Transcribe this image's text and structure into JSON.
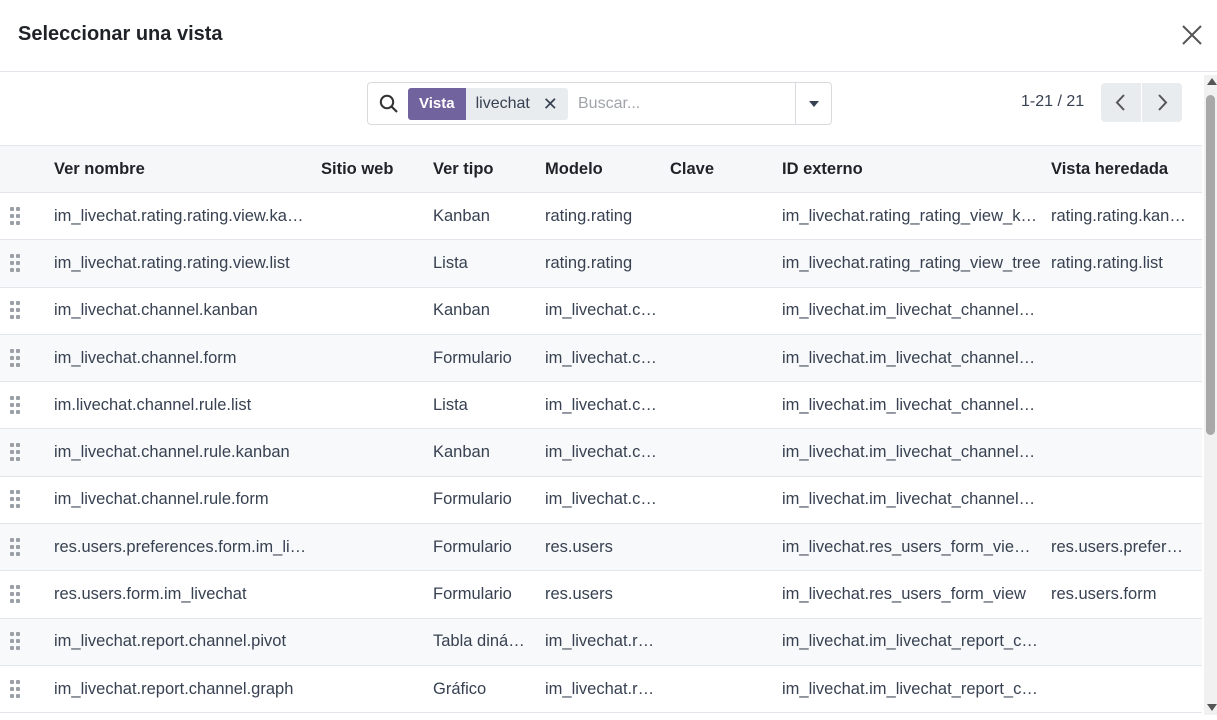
{
  "dialog": {
    "title": "Seleccionar una vista"
  },
  "search": {
    "facet_label": "Vista",
    "facet_value": "livechat",
    "placeholder": "Buscar..."
  },
  "pager": {
    "value": "1-21 / 21"
  },
  "table": {
    "columns": [
      "Ver nombre",
      "Sitio web",
      "Ver tipo",
      "Modelo",
      "Clave",
      "ID externo",
      "Vista heredada"
    ],
    "rows": [
      {
        "name": "im_livechat.rating.rating.view.kanban",
        "website": "",
        "type": "Kanban",
        "model": "rating.rating",
        "key": "",
        "external_id": "im_livechat.rating_rating_view_kanban",
        "inherited": "rating.rating.kanban"
      },
      {
        "name": "im_livechat.rating.rating.view.list",
        "website": "",
        "type": "Lista",
        "model": "rating.rating",
        "key": "",
        "external_id": "im_livechat.rating_rating_view_tree",
        "inherited": "rating.rating.list"
      },
      {
        "name": "im_livechat.channel.kanban",
        "website": "",
        "type": "Kanban",
        "model": "im_livechat.channel",
        "key": "",
        "external_id": "im_livechat.im_livechat_channel_view_kanban",
        "inherited": ""
      },
      {
        "name": "im_livechat.channel.form",
        "website": "",
        "type": "Formulario",
        "model": "im_livechat.channel",
        "key": "",
        "external_id": "im_livechat.im_livechat_channel_view_form",
        "inherited": ""
      },
      {
        "name": "im.livechat.channel.rule.list",
        "website": "",
        "type": "Lista",
        "model": "im_livechat.channel.rule",
        "key": "",
        "external_id": "im_livechat.im_livechat_channel_rule_view_tree",
        "inherited": ""
      },
      {
        "name": "im_livechat.channel.rule.kanban",
        "website": "",
        "type": "Kanban",
        "model": "im_livechat.channel.rule",
        "key": "",
        "external_id": "im_livechat.im_livechat_channel_rule_view_kanban",
        "inherited": ""
      },
      {
        "name": "im_livechat.channel.rule.form",
        "website": "",
        "type": "Formulario",
        "model": "im_livechat.channel.rule",
        "key": "",
        "external_id": "im_livechat.im_livechat_channel_rule_view_form",
        "inherited": ""
      },
      {
        "name": "res.users.preferences.form.im_livechat",
        "website": "",
        "type": "Formulario",
        "model": "res.users",
        "key": "",
        "external_id": "im_livechat.res_users_form_view_simple",
        "inherited": "res.users.preferences.form"
      },
      {
        "name": "res.users.form.im_livechat",
        "website": "",
        "type": "Formulario",
        "model": "res.users",
        "key": "",
        "external_id": "im_livechat.res_users_form_view",
        "inherited": "res.users.form"
      },
      {
        "name": "im_livechat.report.channel.pivot",
        "website": "",
        "type": "Tabla dinámica",
        "model": "im_livechat.report.channel",
        "key": "",
        "external_id": "im_livechat.im_livechat_report_channel_view_pivot",
        "inherited": ""
      },
      {
        "name": "im_livechat.report.channel.graph",
        "website": "",
        "type": "Gráfico",
        "model": "im_livechat.report.channel",
        "key": "",
        "external_id": "im_livechat.im_livechat_report_channel_view_graph",
        "inherited": ""
      }
    ]
  },
  "colors": {
    "facet": "#71639e",
    "header_bg": "#f6f7f9",
    "stripe": "#f8f9fa"
  }
}
